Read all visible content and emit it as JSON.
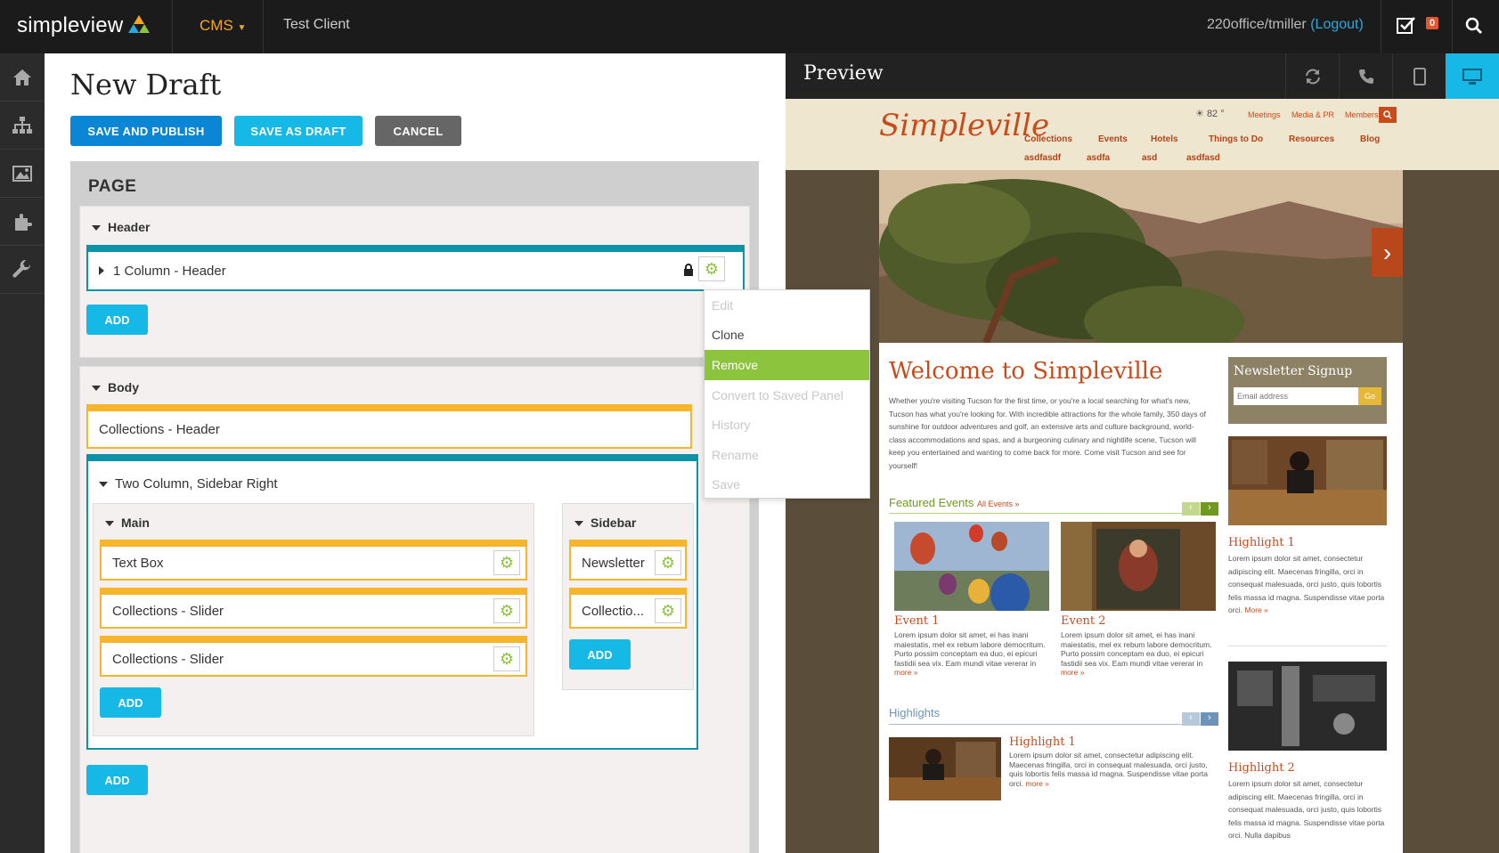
{
  "topbar": {
    "brand": "simpleview",
    "module": "CMS",
    "client": "Test Client",
    "user": "220office/tmiller",
    "logout": "(Logout)",
    "task_count": "0"
  },
  "editor": {
    "title": "New Draft",
    "buttons": {
      "publish": "SAVE AND PUBLISH",
      "draft": "SAVE AS DRAFT",
      "cancel": "CANCEL"
    },
    "page_label": "PAGE",
    "header_section": {
      "label": "Header",
      "rows": [
        "1 Column - Header"
      ],
      "add": "ADD"
    },
    "body_section": {
      "label": "Body",
      "rows": [
        "Collections - Header",
        "Two Column, Sidebar Right"
      ],
      "main": {
        "label": "Main",
        "rows": [
          "Text Box",
          "Collections - Slider",
          "Collections - Slider"
        ],
        "add": "ADD"
      },
      "sidebar": {
        "label": "Sidebar",
        "rows": [
          "Newsletter",
          "Collectio..."
        ],
        "add": "ADD"
      },
      "add": "ADD"
    }
  },
  "context_menu": {
    "items": [
      {
        "label": "Edit",
        "enabled": false
      },
      {
        "label": "Clone",
        "enabled": true
      },
      {
        "label": "Remove",
        "enabled": true,
        "active": true
      },
      {
        "label": "Convert to Saved Panel",
        "enabled": false
      },
      {
        "label": "History",
        "enabled": false
      },
      {
        "label": "Rename",
        "enabled": false
      },
      {
        "label": "Save",
        "enabled": false
      }
    ],
    "active_color": "#8cc43d"
  },
  "preview": {
    "title": "Preview",
    "site": {
      "logo": "Simpleville",
      "weather": "82 °",
      "top_links": [
        "Meetings",
        "Media & PR",
        "Members"
      ],
      "nav": [
        "Collections",
        "Events",
        "Hotels",
        "Things to Do",
        "Resources",
        "Blog"
      ],
      "nav2": [
        "asdfasdf",
        "asdfa",
        "asd",
        "asdfasd"
      ],
      "welcome": "Welcome to Simpleville",
      "intro": "Whether you're visiting Tucson for the first time, or you're a local searching for what's new, Tucson has what you're looking for. With incredible attractions for the whole family, 350 days of sunshine for outdoor adventures and golf, an extensive arts and culture background, world-class accommodations and spas, and a burgeoning culinary and nightlife scene, Tucson will keep you entertained and wanting to come back for more. Come visit Tucson and see for yourself!",
      "featured_events": "Featured Events",
      "all_events": "All Events »",
      "event1": "Event 1",
      "event2": "Event 2",
      "event_text": "Lorem ipsum dolor sit amet, ei has inani maiestatis, mel ex rebum labore democritum. Purto possim conceptam ea duo, ei epicuri fastidii sea vix. Eam mundi vitae vererar in",
      "more": "more »",
      "highlights": "Highlights",
      "highlight1": "Highlight 1",
      "highlight_text": "Lorem ipsum dolor sit amet, consectetur adipiscing elit. Maecenas fringilla, orci in consequat malesuada, orci justo, quis lobortis felis massa id magna. Suspendisse vitae porta orci.",
      "newsletter": "Newsletter Signup",
      "email_placeholder": "Email address",
      "go": "Go",
      "side_highlight1": "Highlight 1",
      "side_highlight2": "Highlight 2",
      "side_text": "Lorem ipsum dolor sit amet, consectetur adipiscing elit. Maecenas fringilla, orci in consequat malesuada, orci justo, quis lobortis felis massa id magna. Suspendisse vitae porta orci.",
      "side_text2": "Lorem ipsum dolor sit amet, consectetur adipiscing elit. Maecenas fringilla, orci in consequat malesuada, orci justo, quis lobortis felis massa id magna. Suspendisse vitae porta orci. Nulla dapibus",
      "side_more": "More »"
    }
  }
}
